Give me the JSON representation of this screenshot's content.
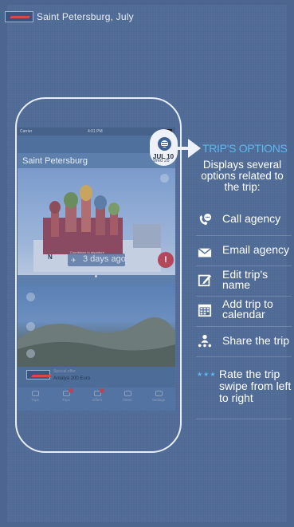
{
  "app": {
    "status_carrier": "Carrier",
    "status_time": "4:01 PM",
    "trip_title": "Saint Petersburg, July",
    "city_label": "Saint Petersburg",
    "days_small": "Countdown to departure",
    "days_text": "3 days ago",
    "alert_symbol": "!",
    "compass_letter": "N",
    "offer_label": "Special offer",
    "offer_text": "Antalya 200 Euro",
    "tabs": [
      "Trips",
      "Trips",
      "Offers",
      "News",
      "Settings"
    ],
    "options_date_1": "JUL 10",
    "options_date_2": "Wed 26"
  },
  "tooltip": {
    "heading": "TRIP'S OPTIONS",
    "description": "Displays several options related to the trip:",
    "options": [
      {
        "icon": "phone-chat-icon",
        "label": "Call agency"
      },
      {
        "icon": "envelope-icon",
        "label": "Email agency"
      },
      {
        "icon": "edit-icon",
        "label": "Edit trip's name"
      },
      {
        "icon": "calendar-icon",
        "label": "Add trip to calendar"
      },
      {
        "icon": "share-icon",
        "label": "Share the trip"
      }
    ],
    "stars": "★★★",
    "rate_text": "Rate the trip swipe from left to right"
  },
  "colors": {
    "background": "#4c6690",
    "accent": "#5cb8f0",
    "badge": "#b3465a"
  }
}
